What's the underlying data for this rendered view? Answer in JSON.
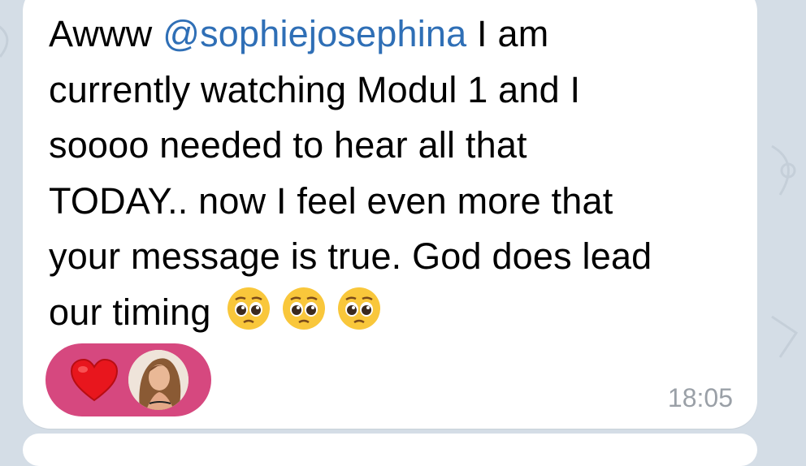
{
  "message": {
    "intro": "Awww ",
    "mention": "@sophiejosephina",
    "line1_rest": " I am",
    "line2": "currently watching Modul 1 and I",
    "line3": "soooo needed to hear all that",
    "line4": "TODAY.. now I feel even more that",
    "line5": "your message is true. God does lead",
    "line6": "our timing",
    "emojis": [
      "pleading-face",
      "pleading-face",
      "pleading-face"
    ],
    "time": "18:05"
  },
  "reaction": {
    "emoji": "heart",
    "reactor_avatar": "user-avatar",
    "pill_color": "#d6487f"
  },
  "colors": {
    "mention": "#2f6fb6",
    "background": "#d4dde6",
    "timestamp": "#9aa0a7"
  }
}
